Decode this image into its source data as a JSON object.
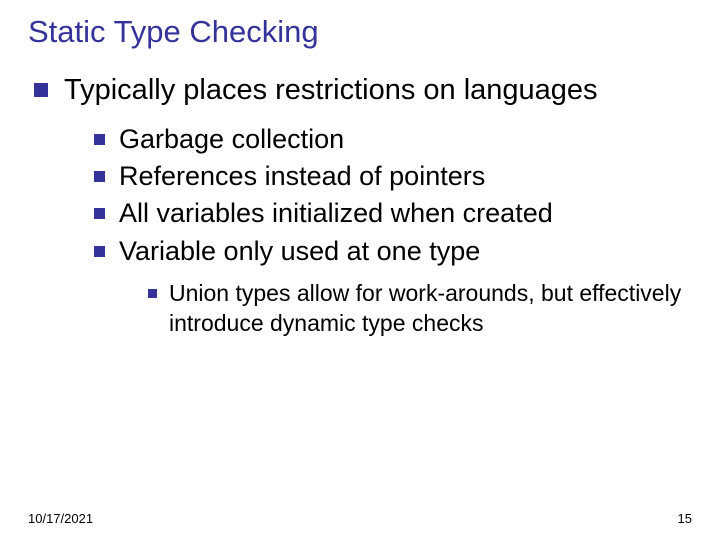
{
  "title": "Static Type Checking",
  "lvl1": {
    "text": "Typically places restrictions on languages"
  },
  "lvl2": {
    "items": [
      "Garbage collection",
      "References instead of pointers",
      "All variables initialized when created",
      "Variable only used at one type"
    ]
  },
  "lvl3": {
    "text": "Union types allow for work-arounds, but effectively introduce dynamic type checks"
  },
  "footer": {
    "date": "10/17/2021",
    "page": "15"
  }
}
